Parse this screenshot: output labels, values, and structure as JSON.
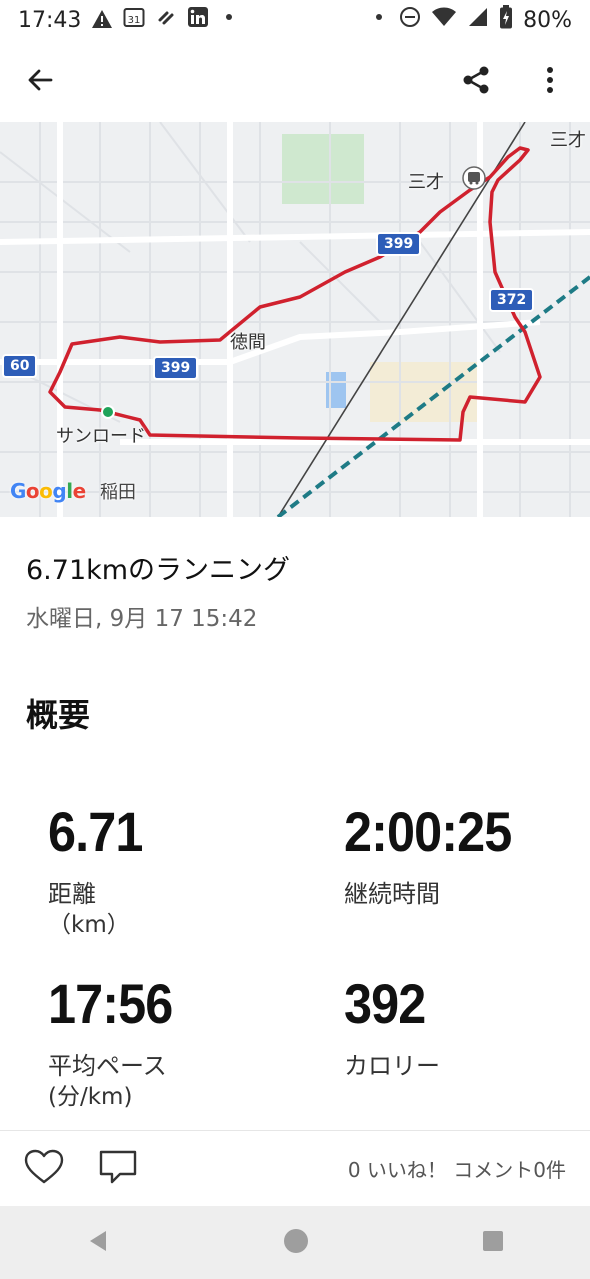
{
  "status_bar": {
    "time": "17:43",
    "battery": "80%",
    "left_icons": [
      "warning-icon",
      "calendar-icon",
      "link-icon",
      "linkedin-icon",
      "dot-icon"
    ],
    "calendar_day": "31",
    "right_icons": [
      "dot-icon",
      "do-not-disturb-icon",
      "wifi-icon",
      "signal-icon",
      "battery-charging-icon"
    ]
  },
  "app_bar": {
    "icons": [
      "back-arrow-icon",
      "share-icon",
      "more-vert-icon"
    ]
  },
  "map": {
    "labels": {
      "sansai": "三才",
      "sansai_edge": "三才",
      "tokuma": "徳間",
      "sunroad": "サンロード",
      "inada": "稲田"
    },
    "routes": {
      "r399_top": "399",
      "r399_mid": "399",
      "r372": "372",
      "r60": "60"
    },
    "google_logo": [
      "G",
      "o",
      "o",
      "g",
      "l",
      "e"
    ],
    "colors": {
      "route": "#d0212e",
      "start_marker": "#1fa35a",
      "rail": "#1e7b86",
      "badge": "#2d5db8"
    }
  },
  "activity": {
    "title": "6.71kmのランニング",
    "date": "水曜日, 9月 17 15:42"
  },
  "summary": {
    "heading": "概要",
    "stats": [
      {
        "value": "6.71",
        "label": "距離",
        "unit": "（km）"
      },
      {
        "value": "2:00:25",
        "label": "継続時間",
        "unit": ""
      },
      {
        "value": "17:56",
        "label": "平均ペース",
        "unit": "(分/km)"
      },
      {
        "value": "392",
        "label": "カロリー",
        "unit": ""
      }
    ]
  },
  "social": {
    "summary": "0 いいね！ コメント0件",
    "icons": [
      "heart-icon",
      "comment-icon"
    ]
  },
  "nav_bar": {
    "icons": [
      "nav-back-icon",
      "nav-home-icon",
      "nav-recents-icon"
    ]
  }
}
